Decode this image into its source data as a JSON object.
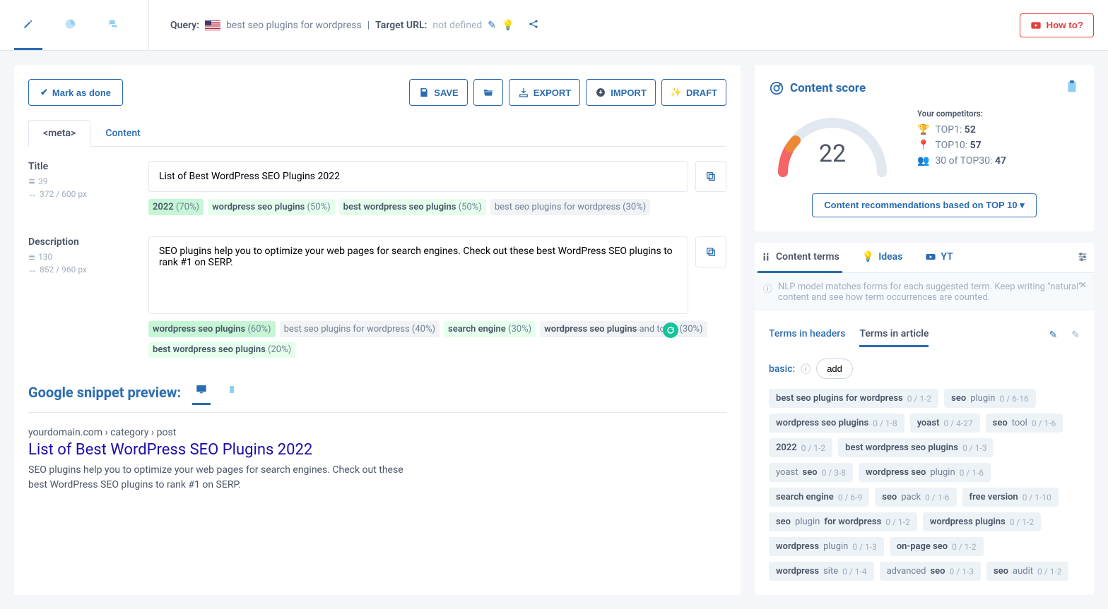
{
  "topbar": {
    "query_label": "Query:",
    "query_text": "best seo plugins for wordpress",
    "target_label": "Target URL:",
    "target_value": "not defined",
    "howto": "How to?"
  },
  "actions": {
    "mark_done": "Mark as done",
    "save": "SAVE",
    "export": "EXPORT",
    "import": "IMPORT",
    "draft": "DRAFT"
  },
  "tabs": {
    "meta": "<meta>",
    "content": "Content"
  },
  "title_field": {
    "label": "Title",
    "char_count": "39",
    "px": "372 / 600 px",
    "value": "List of Best WordPress SEO Plugins 2022",
    "chips": [
      {
        "text_b": "2022",
        "pct": " (70%)",
        "cls": "green"
      },
      {
        "text_b": "wordpress seo plugins",
        "pct": " (50%)",
        "cls": "lightgreen"
      },
      {
        "text_b": "best wordpress seo plugins",
        "pct": " (50%)",
        "cls": "lightgreen"
      },
      {
        "text_plain": "best seo plugins for wordpress",
        "pct": " (30%)",
        "cls": "gray"
      }
    ]
  },
  "desc_field": {
    "label": "Description",
    "char_count": "130",
    "px": "852 / 960 px",
    "value": "SEO plugins help you to optimize your web pages for search engines. Check out these best WordPress SEO plugins to rank #1 on SERP.",
    "chips": [
      {
        "text_b": "wordpress seo plugins",
        "pct": " (60%)",
        "cls": "green"
      },
      {
        "text_plain": "best seo plugins for wordpress",
        "pct": " (40%)",
        "cls": "gray"
      },
      {
        "text_b": "search engine",
        "pct": " (30%)",
        "cls": "lightgreen"
      },
      {
        "text_pre": "wordpress seo plugins",
        "text_plain": " and tools",
        "pct": " (30%)",
        "cls": "gray"
      },
      {
        "text_b": "best wordpress seo plugins",
        "pct": " (20%)",
        "cls": "lightgreen"
      }
    ]
  },
  "preview": {
    "heading": "Google snippet preview:",
    "url": "yourdomain.com › category › post",
    "title": "List of Best WordPress SEO Plugins 2022",
    "desc": "SEO plugins help you to optimize your web pages for search engines. Check out these best WordPress SEO plugins to rank #1 on SERP."
  },
  "score": {
    "heading": "Content score",
    "value": "22",
    "comp_heading": "Your competitors:",
    "rows": [
      {
        "label": "TOP1: ",
        "val": "52"
      },
      {
        "label": "TOP10: ",
        "val": "57"
      },
      {
        "label": "30 of TOP30: ",
        "val": "47"
      }
    ],
    "rec_btn": "Content recommendations based on TOP 10"
  },
  "side": {
    "tab_terms": "Content terms",
    "tab_ideas": "Ideas",
    "tab_yt": "YT",
    "note": "NLP model matches forms for each suggested term. Keep writing \"natural\" content and see how term occurrences are counted.",
    "sub_headers": "Terms in headers",
    "sub_article": "Terms in article",
    "basic": "basic:",
    "add": "add",
    "terms": [
      {
        "pre": "",
        "b": "best seo plugins for wordpress",
        "post": "",
        "c": "0 / 1-2"
      },
      {
        "pre": "",
        "b": "seo",
        "post": " plugin",
        "c": "0 / 6-16"
      },
      {
        "pre": "",
        "b": "wordpress seo plugins",
        "post": "",
        "c": "0 / 1-8"
      },
      {
        "pre": "",
        "b": "yoast",
        "post": "",
        "c": "0 / 4-27"
      },
      {
        "pre": "",
        "b": "seo",
        "post": " tool",
        "c": "0 / 1-6"
      },
      {
        "pre": "",
        "b": "2022",
        "post": "",
        "c": "0 / 1-2"
      },
      {
        "pre": "",
        "b": "best wordpress seo plugins",
        "post": "",
        "c": "0 / 1-3"
      },
      {
        "pre": "yoast ",
        "b": "seo",
        "post": "",
        "c": "0 / 3-8"
      },
      {
        "pre": "",
        "b": "wordpress seo",
        "post": " plugin",
        "c": "0 / 1-6"
      },
      {
        "pre": "",
        "b": "search engine",
        "post": "",
        "c": "0 / 6-9"
      },
      {
        "pre": "",
        "b": "seo",
        "post": " pack",
        "c": "0 / 1-6"
      },
      {
        "pre": "",
        "b": "free version",
        "post": "",
        "c": "0 / 1-10"
      },
      {
        "pre": "",
        "b": "seo",
        "post": " plugin ",
        "b2": "for wordpress",
        "c": "0 / 1-2"
      },
      {
        "pre": "",
        "b": "wordpress plugins",
        "post": "",
        "c": "0 / 1-2"
      },
      {
        "pre": "",
        "b": "wordpress",
        "post": " plugin",
        "c": "0 / 1-3"
      },
      {
        "pre": "",
        "b": "on-page seo",
        "post": "",
        "c": "0 / 1-2"
      },
      {
        "pre": "",
        "b": "wordpress",
        "post": " site",
        "c": "0 / 1-4"
      },
      {
        "pre": "advanced ",
        "b": "seo",
        "post": "",
        "c": "0 / 1-3"
      },
      {
        "pre": "",
        "b": "seo",
        "post": " audit",
        "c": "0 / 1-2"
      }
    ]
  }
}
